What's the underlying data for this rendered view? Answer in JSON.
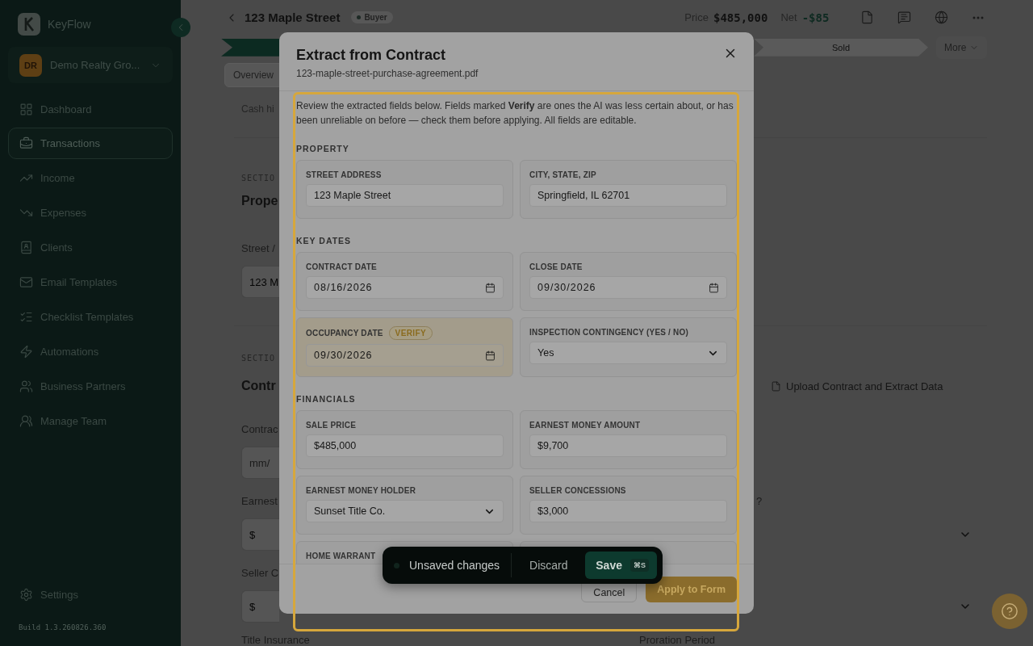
{
  "sidebar": {
    "brand": "KeyFlow",
    "org": {
      "initials": "DR",
      "name": "Demo Realty Gro..."
    },
    "nav": [
      {
        "label": "Dashboard",
        "selected": false
      },
      {
        "label": "Transactions",
        "selected": true
      },
      {
        "label": "Income",
        "selected": false
      },
      {
        "label": "Expenses",
        "selected": false
      },
      {
        "label": "Clients",
        "selected": false
      },
      {
        "label": "Email Templates",
        "selected": false
      },
      {
        "label": "Checklist Templates",
        "selected": false
      },
      {
        "label": "Automations",
        "selected": false
      },
      {
        "label": "Business Partners",
        "selected": false
      },
      {
        "label": "Manage Team",
        "selected": false
      }
    ],
    "settings": "Settings",
    "build": "Build 1.3.260826.360"
  },
  "header": {
    "title": "123 Maple Street",
    "badge": "Buyer",
    "price_label": "Price",
    "price": "$485,000",
    "net_label": "Net",
    "net": "-$85"
  },
  "stages": {
    "visible_stage": "Sold",
    "more": "More"
  },
  "tabs": [
    {
      "label": "Overview",
      "selected": true
    }
  ],
  "page": {
    "note": "Cash hi",
    "sections": [
      {
        "eyebrow": "SECTIO",
        "title": "Prope",
        "rows": [
          {
            "label": "Street /",
            "value": "123 M"
          }
        ]
      },
      {
        "eyebrow": "SECTIO",
        "title": "Contr",
        "action": "Upload Contract and Extract Data",
        "rows": [
          {
            "kind": "input",
            "label": "Contrac",
            "placeholder": "mm/"
          },
          {
            "kind": "select",
            "label": "Earnest",
            "value": "$",
            "side_label": "?"
          },
          {
            "kind": "select",
            "label": "Seller C",
            "value": "$"
          }
        ]
      }
    ],
    "bottom": {
      "left": "Title Insurance",
      "right": "Proration Period"
    }
  },
  "modal": {
    "title": "Extract from Contract",
    "file": "123-maple-street-purchase-agreement.pdf",
    "intro": "Review the extracted fields below. Fields marked **Verify** are ones the AI was less certain about, or has been unreliable on before — check them before applying. All fields are editable.",
    "groups": [
      {
        "title": "PROPERTY",
        "fields": [
          {
            "kind": "text",
            "label": "STREET ADDRESS",
            "value": "123 Maple Street"
          },
          {
            "kind": "text",
            "label": "CITY, STATE, ZIP",
            "value": "Springfield, IL 62701"
          }
        ]
      },
      {
        "title": "KEY DATES",
        "fields": [
          {
            "kind": "date",
            "label": "CONTRACT DATE",
            "value": "08/16/2026"
          },
          {
            "kind": "date",
            "label": "CLOSE DATE",
            "value": "09/30/2026"
          },
          {
            "kind": "date",
            "label": "OCCUPANCY DATE",
            "value": "09/30/2026",
            "badge": "VERIFY"
          },
          {
            "kind": "select",
            "label": "INSPECTION CONTINGENCY (YES / NO)",
            "value": "Yes"
          }
        ]
      },
      {
        "title": "FINANCIALS",
        "fields": [
          {
            "kind": "text",
            "label": "SALE PRICE",
            "value": "$485,000"
          },
          {
            "kind": "text",
            "label": "EARNEST MONEY AMOUNT",
            "value": "$9,700"
          },
          {
            "kind": "select",
            "label": "EARNEST MONEY HOLDER",
            "value": "Sunset Title Co."
          },
          {
            "kind": "text",
            "label": "SELLER CONCESSIONS",
            "value": "$3,000"
          },
          {
            "kind": "text",
            "label": "HOME WARRANT"
          },
          {
            "kind": "blank"
          }
        ]
      }
    ],
    "cancel": "Cancel",
    "apply": "Apply to Form"
  },
  "unsaved_bar": {
    "label": "Unsaved changes",
    "discard": "Discard",
    "save": "Save",
    "shortcut": "⌘S"
  }
}
